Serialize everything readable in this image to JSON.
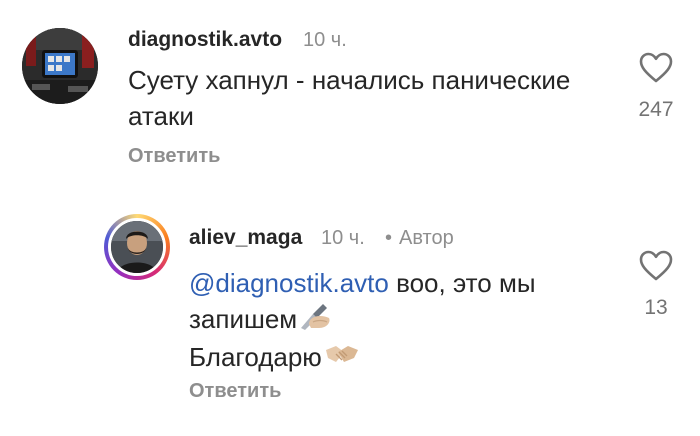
{
  "comments": [
    {
      "username": "diagnostik.avto",
      "time": "10 ч.",
      "text_line1": "Суету хапнул - начались панические",
      "text_line2": "атаки",
      "likes": "247",
      "reply_label": "Ответить",
      "avatar_icon": "avatar-car-diagnostic-tablet"
    },
    {
      "username": "aliev_maga",
      "time": "10 ч.",
      "separator": "•",
      "author_badge": "Автор",
      "mention": "@diagnostik.avto",
      "text_after_mention": " воо, это мы",
      "text_line2": "запишем",
      "text_line3": "Благодарю",
      "emoji_line2": "writing-hand-emoji",
      "emoji_line3": "handshake-emoji",
      "likes": "13",
      "reply_label": "Ответить",
      "avatar_icon": "avatar-man-photo"
    }
  ],
  "colors": {
    "text": "#262626",
    "secondary": "#8e8e8e",
    "mention": "#2f5fb3"
  }
}
